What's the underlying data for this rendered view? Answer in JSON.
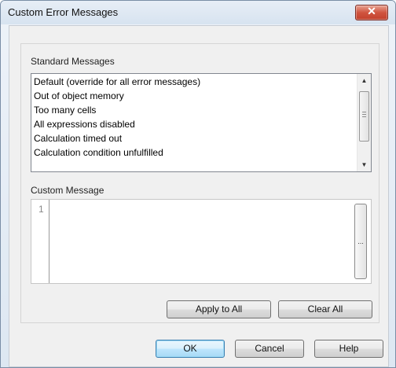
{
  "window": {
    "title": "Custom Error Messages",
    "close_glyph": "✕"
  },
  "standard_messages": {
    "label": "Standard Messages",
    "items": [
      "Default (override for all error messages)",
      "Out of object memory",
      "Too many cells",
      "All expressions disabled",
      "Calculation timed out",
      "Calculation condition unfulfilled"
    ],
    "scroll_up_glyph": "▲",
    "scroll_down_glyph": "▼"
  },
  "custom_message": {
    "label": "Custom Message",
    "line_number": "1",
    "value": "",
    "ellipsis_label": "..."
  },
  "actions": {
    "apply_all": "Apply to All",
    "clear_all": "Clear All"
  },
  "footer": {
    "ok": "OK",
    "cancel": "Cancel",
    "help": "Help"
  },
  "colors": {
    "close_button": "#c3412c",
    "default_button_border": "#3c7fb1"
  },
  "icons": [
    "close-icon",
    "scroll-up-icon",
    "scroll-down-icon",
    "scroll-grip-icon",
    "ellipsis-icon"
  ]
}
